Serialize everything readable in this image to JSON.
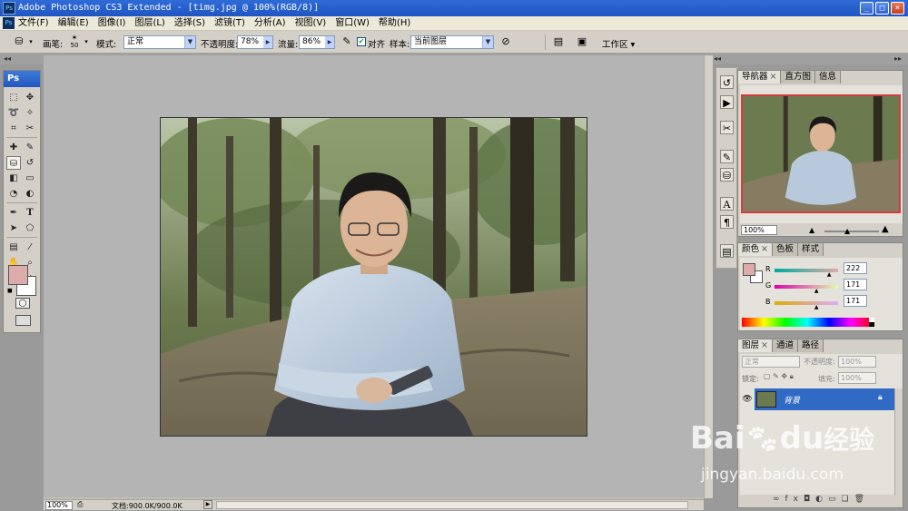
{
  "window": {
    "app_icon": "Ps",
    "title": "Adobe Photoshop CS3 Extended - [timg.jpg @ 100%(RGB/8)]",
    "controls": [
      "_",
      "□",
      "×"
    ]
  },
  "menu": [
    "文件(F)",
    "编辑(E)",
    "图像(I)",
    "图层(L)",
    "选择(S)",
    "滤镜(T)",
    "分析(A)",
    "视图(V)",
    "窗口(W)",
    "帮助(H)"
  ],
  "options": {
    "brush_label": "画笔:",
    "brush_size": "50",
    "mode_label": "模式:",
    "mode_value": "正常",
    "opacity_label": "不透明度:",
    "opacity_value": "78%",
    "flow_label": "流量:",
    "flow_value": "86%",
    "align_label": "对齐",
    "sample_label": "样本:",
    "sample_value": "当前图层",
    "workspace_label": "工作区"
  },
  "toolbox": {
    "logo": "Ps"
  },
  "status": {
    "zoom": "100%",
    "doc_info": "文档:900.0K/900.0K"
  },
  "navigator": {
    "tabs": [
      "导航器",
      "直方图",
      "信息"
    ],
    "zoom": "100%"
  },
  "color": {
    "tabs": [
      "颜色",
      "色板",
      "样式"
    ],
    "r_label": "R",
    "r_value": "222",
    "g_label": "G",
    "g_value": "171",
    "b_label": "B",
    "b_value": "171",
    "r_level": 0.87,
    "g_level": 0.67,
    "b_level": 0.67,
    "foreground": "#deabab",
    "background": "#ffffff"
  },
  "layers": {
    "tabs": [
      "图层",
      "通道",
      "路径"
    ],
    "blend_mode": "正常",
    "opacity_label": "不透明度:",
    "opacity_value": "100%",
    "lock_label": "锁定:",
    "fill_label": "填充:",
    "fill_value": "100%",
    "layer_name": "背景"
  },
  "watermark": {
    "brand": "Bai",
    "brand2": "du",
    "cn": "经验",
    "url": "jingyan.baidu.com"
  }
}
